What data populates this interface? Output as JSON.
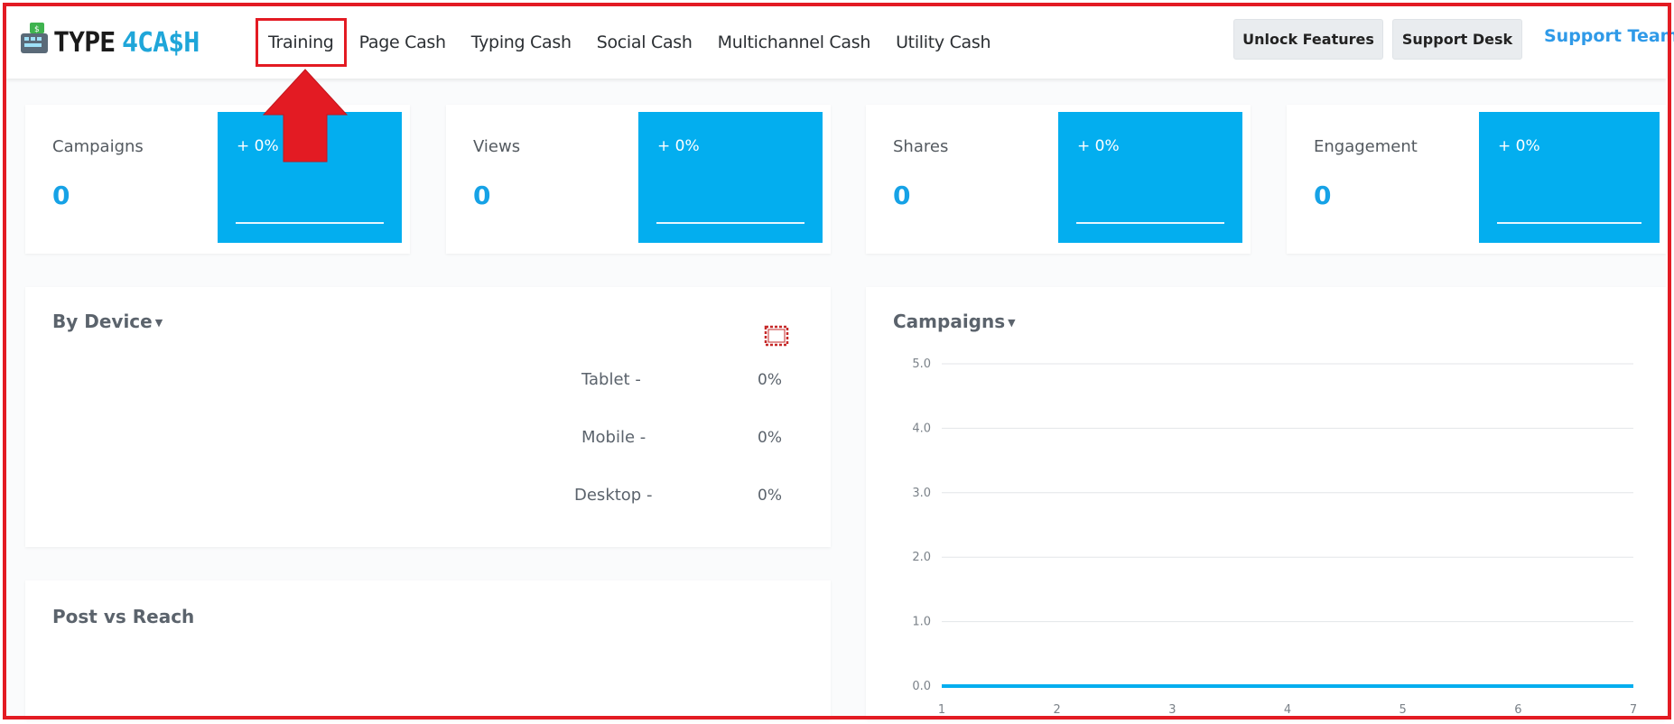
{
  "brand": {
    "logo_text": "TYPE4CASH",
    "logo_icon": "keyboard-icon"
  },
  "nav": {
    "items": [
      {
        "label": "Training",
        "highlighted": true
      },
      {
        "label": "Page Cash"
      },
      {
        "label": "Typing Cash"
      },
      {
        "label": "Social Cash"
      },
      {
        "label": "Multichannel Cash"
      },
      {
        "label": "Utility Cash"
      }
    ],
    "unlock_label": "Unlock Features",
    "desk_label": "Support Desk",
    "support_label": "Support Team"
  },
  "stats": [
    {
      "label": "Campaigns",
      "value": "0",
      "change": "+ 0%"
    },
    {
      "label": "Views",
      "value": "0",
      "change": "+ 0%"
    },
    {
      "label": "Shares",
      "value": "0",
      "change": "+ 0%"
    },
    {
      "label": "Engagement",
      "value": "0",
      "change": "+ 0%"
    }
  ],
  "by_device": {
    "title": "By Device",
    "rows": [
      {
        "label": "Tablet -",
        "pct": "0%"
      },
      {
        "label": "Mobile -",
        "pct": "0%"
      },
      {
        "label": "Desktop -",
        "pct": "0%"
      }
    ]
  },
  "post_reach": {
    "title": "Post vs Reach"
  },
  "campaigns_chart": {
    "title": "Campaigns"
  },
  "colors": {
    "accent": "#03aeef",
    "annotation": "#e31b23",
    "link": "#2f9ae8"
  },
  "chart_data": {
    "type": "line",
    "title": "Campaigns",
    "x": [
      1,
      2,
      3,
      4,
      5,
      6,
      7
    ],
    "x_tick_labels": [
      "1",
      "2",
      "3",
      "4",
      "5",
      "6",
      "7"
    ],
    "y_tick_labels": [
      "5.0",
      "4.0",
      "3.0",
      "2.0",
      "1.0",
      "0.0"
    ],
    "ylim": [
      0,
      5
    ],
    "series": [
      {
        "values": [
          0,
          0,
          0,
          0,
          0,
          0,
          0
        ],
        "color": "#03aeef"
      }
    ],
    "grid": true
  }
}
